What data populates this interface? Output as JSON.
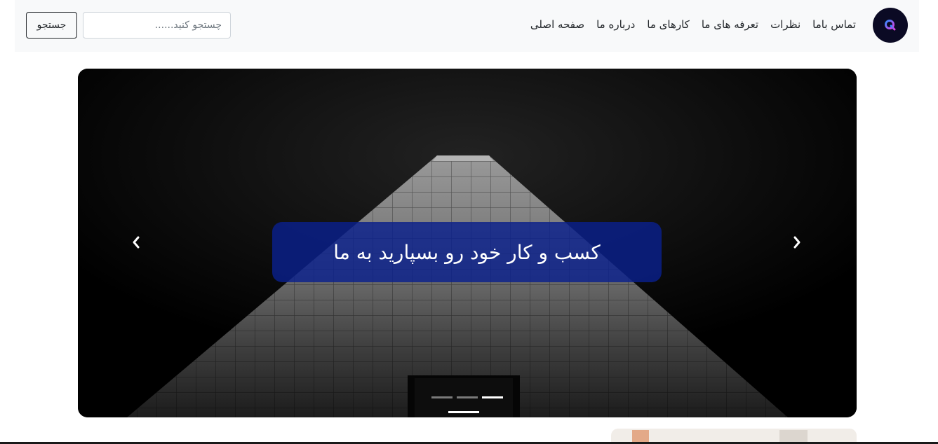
{
  "header": {
    "nav_links": [
      "صفحه اصلی",
      "درباره ما",
      "کارهای ما",
      "تعرفه های ما",
      "نظرات",
      "تماس باما"
    ],
    "search": {
      "placeholder": "چستجو کنید......",
      "button_label": "جستجو"
    },
    "logo_icon": "q-logo-icon"
  },
  "carousel": {
    "caption": "کسب و کار خود رو بسپارید به ما",
    "caption_background": "#0a208c",
    "prev_icon": "chevron-left-icon",
    "next_icon": "chevron-right-icon",
    "slide_count": 3,
    "active_slide": 3
  }
}
